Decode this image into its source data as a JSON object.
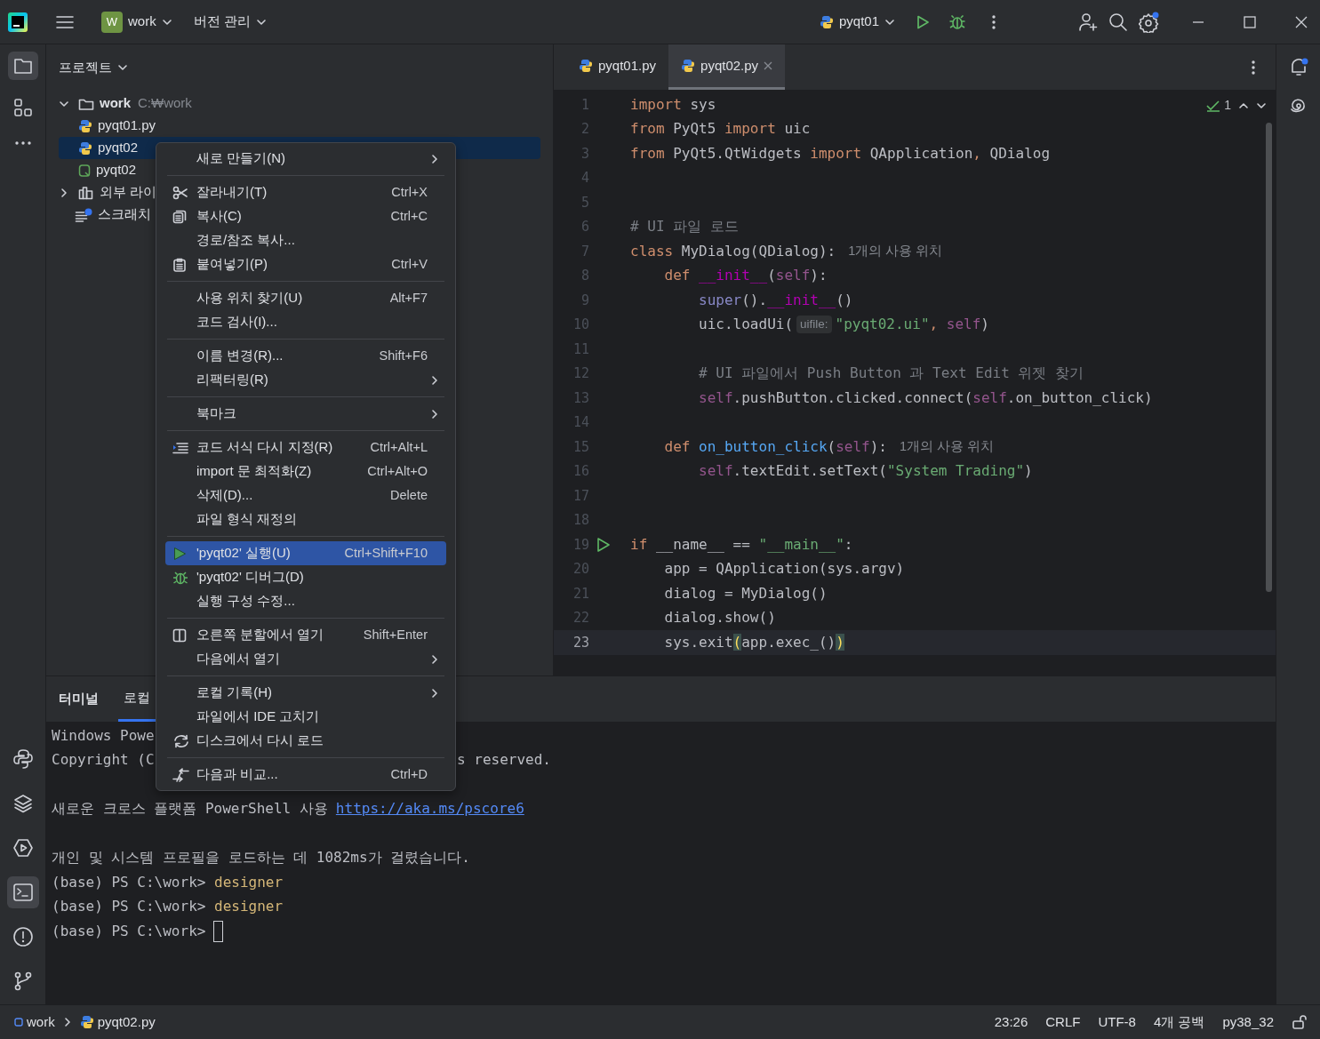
{
  "title_bar": {
    "project_initial": "W",
    "project": "work",
    "vcs": "버전 관리",
    "run_config": "pyqt01"
  },
  "project_panel": {
    "title": "프로젝트",
    "tree": [
      {
        "label": "work",
        "path": "C:₩work",
        "kind": "folder",
        "expanded": true,
        "selected": false,
        "children": [
          {
            "label": "pyqt01.py",
            "kind": "python",
            "selected": false
          },
          {
            "label": "pyqt02",
            "kind": "python",
            "selected": true
          },
          {
            "label": "pyqt02",
            "kind": "qt",
            "selected": false
          }
        ]
      },
      {
        "label": "외부 라이",
        "kind": "library",
        "expanded": false,
        "selected": false
      },
      {
        "label": "스크래치",
        "kind": "scratch",
        "selected": false
      }
    ]
  },
  "editor": {
    "tabs": [
      {
        "label": "pyqt01.py",
        "selected": false
      },
      {
        "label": "pyqt02.py",
        "selected": true
      }
    ],
    "inspections": "1",
    "lines": [
      {
        "number": "1",
        "current": false,
        "run": false,
        "tokens": [
          {
            "kind": "keyword",
            "text": "import"
          },
          {
            "kind": "plain",
            "text": " sys"
          }
        ]
      },
      {
        "number": "2",
        "current": false,
        "run": false,
        "tokens": [
          {
            "kind": "keyword",
            "text": "from"
          },
          {
            "kind": "plain",
            "text": " PyQt5 "
          },
          {
            "kind": "keyword",
            "text": "import"
          },
          {
            "kind": "plain",
            "text": " uic"
          }
        ]
      },
      {
        "number": "3",
        "current": false,
        "run": false,
        "tokens": [
          {
            "kind": "keyword",
            "text": "from"
          },
          {
            "kind": "plain",
            "text": " PyQt5.QtWidgets "
          },
          {
            "kind": "keyword",
            "text": "import"
          },
          {
            "kind": "plain",
            "text": " QApplication"
          },
          {
            "kind": "keyword",
            "text": ","
          },
          {
            "kind": "plain",
            "text": " QDialog"
          }
        ]
      },
      {
        "number": "4",
        "current": false,
        "run": false
      },
      {
        "number": "5",
        "current": false,
        "run": false
      },
      {
        "number": "6",
        "current": false,
        "run": false,
        "tokens": [
          {
            "kind": "comment",
            "text": "# UI 파일 로드"
          }
        ]
      },
      {
        "number": "7",
        "current": false,
        "run": false,
        "tokens": [
          {
            "kind": "keyword",
            "text": "class"
          },
          {
            "kind": "plain",
            "text": " MyDialog(QDialog):"
          },
          {
            "kind": "hint",
            "text": "1개의 사용 위치"
          }
        ]
      },
      {
        "number": "8",
        "current": false,
        "run": false,
        "tokens": [
          {
            "kind": "keyword",
            "text": "    def"
          },
          {
            "kind": "magic",
            "text": " __init__"
          },
          {
            "kind": "plain",
            "text": "("
          },
          {
            "kind": "self",
            "text": "self"
          },
          {
            "kind": "plain",
            "text": "):"
          }
        ]
      },
      {
        "number": "9",
        "current": false,
        "run": false,
        "tokens": [
          {
            "kind": "builtin",
            "text": "        super"
          },
          {
            "kind": "plain",
            "text": "()."
          },
          {
            "kind": "magic",
            "text": "__init__"
          },
          {
            "kind": "plain",
            "text": "()"
          }
        ]
      },
      {
        "number": "10",
        "current": false,
        "run": false,
        "tokens": [
          {
            "kind": "plain",
            "text": "        uic.loadUi("
          },
          {
            "kind": "param",
            "text": "uifile:"
          },
          {
            "kind": "string",
            "text": "\"pyqt02.ui\""
          },
          {
            "kind": "keyword",
            "text": ","
          },
          {
            "kind": "self",
            "text": " self"
          },
          {
            "kind": "plain",
            "text": ")"
          }
        ]
      },
      {
        "number": "11",
        "current": false,
        "run": false
      },
      {
        "number": "12",
        "current": false,
        "run": false,
        "tokens": [
          {
            "kind": "comment",
            "text": "        # UI 파일에서 Push Button 과 Text Edit 위젯 찾기"
          }
        ]
      },
      {
        "number": "13",
        "current": false,
        "run": false,
        "tokens": [
          {
            "kind": "self",
            "text": "        self"
          },
          {
            "kind": "plain",
            "text": ".pushButton.clicked.connect("
          },
          {
            "kind": "self",
            "text": "self"
          },
          {
            "kind": "plain",
            "text": ".on_button_click)"
          }
        ]
      },
      {
        "number": "14",
        "current": false,
        "run": false
      },
      {
        "number": "15",
        "current": false,
        "run": false,
        "tokens": [
          {
            "kind": "keyword",
            "text": "    def"
          },
          {
            "kind": "function",
            "text": " on_button_click"
          },
          {
            "kind": "plain",
            "text": "("
          },
          {
            "kind": "self",
            "text": "self"
          },
          {
            "kind": "plain",
            "text": "):"
          },
          {
            "kind": "hint",
            "text": "1개의 사용 위치"
          }
        ]
      },
      {
        "number": "16",
        "current": false,
        "run": false,
        "tokens": [
          {
            "kind": "self",
            "text": "        self"
          },
          {
            "kind": "plain",
            "text": ".textEdit.setText("
          },
          {
            "kind": "string",
            "text": "\"System Trading\""
          },
          {
            "kind": "plain",
            "text": ")"
          }
        ]
      },
      {
        "number": "17",
        "current": false,
        "run": false
      },
      {
        "number": "18",
        "current": false,
        "run": false
      },
      {
        "number": "19",
        "current": false,
        "run": true,
        "tokens": [
          {
            "kind": "keyword",
            "text": "if"
          },
          {
            "kind": "plain",
            "text": " __name__ == "
          },
          {
            "kind": "string",
            "text": "\"__main__\""
          },
          {
            "kind": "plain",
            "text": ":"
          }
        ]
      },
      {
        "number": "20",
        "current": false,
        "run": false,
        "tokens": [
          {
            "kind": "plain",
            "text": "    app = QApplication(sys.argv)"
          }
        ]
      },
      {
        "number": "21",
        "current": false,
        "run": false,
        "tokens": [
          {
            "kind": "plain",
            "text": "    dialog = MyDialog()"
          }
        ]
      },
      {
        "number": "22",
        "current": false,
        "run": false,
        "tokens": [
          {
            "kind": "plain",
            "text": "    dialog.show()"
          }
        ]
      },
      {
        "number": "23",
        "current": true,
        "run": false,
        "tokens": [
          {
            "kind": "plain",
            "text": "    sys.exit"
          },
          {
            "kind": "match",
            "text": "("
          },
          {
            "kind": "plain",
            "text": "app.exec_()"
          },
          {
            "kind": "match",
            "text": ")"
          }
        ]
      }
    ]
  },
  "context_menu": {
    "items": [
      {
        "kind": "item",
        "label": "새로 만들기(N)",
        "submenu": true,
        "selected": false
      },
      {
        "kind": "separator"
      },
      {
        "kind": "cut",
        "label": "잘라내기(T)",
        "shortcut": "Ctrl+X",
        "submenu": false,
        "selected": false
      },
      {
        "kind": "copy",
        "label": "복사(C)",
        "shortcut": "Ctrl+C",
        "submenu": false,
        "selected": false
      },
      {
        "kind": "item",
        "label": "경로/참조 복사...",
        "submenu": false,
        "selected": false
      },
      {
        "kind": "paste",
        "label": "붙여넣기(P)",
        "shortcut": "Ctrl+V",
        "submenu": false,
        "selected": false
      },
      {
        "kind": "separator"
      },
      {
        "kind": "item",
        "label": "사용 위치 찾기(U)",
        "shortcut": "Alt+F7",
        "submenu": false,
        "selected": false
      },
      {
        "kind": "item",
        "label": "코드 검사(I)...",
        "submenu": false,
        "selected": false
      },
      {
        "kind": "separator"
      },
      {
        "kind": "item",
        "label": "이름 변경(R)...",
        "shortcut": "Shift+F6",
        "submenu": false,
        "selected": false
      },
      {
        "kind": "item",
        "label": "리팩터링(R)",
        "submenu": true,
        "selected": false
      },
      {
        "kind": "separator"
      },
      {
        "kind": "item",
        "label": "북마크",
        "submenu": true,
        "selected": false
      },
      {
        "kind": "separator"
      },
      {
        "kind": "reformat",
        "label": "코드 서식 다시 지정(R)",
        "shortcut": "Ctrl+Alt+L",
        "submenu": false,
        "selected": false
      },
      {
        "kind": "item",
        "label": "import 문 최적화(Z)",
        "shortcut": "Ctrl+Alt+O",
        "submenu": false,
        "selected": false
      },
      {
        "kind": "item",
        "label": "삭제(D)...",
        "shortcut": "Delete",
        "submenu": false,
        "selected": false
      },
      {
        "kind": "item",
        "label": "파일 형식 재정의",
        "submenu": false,
        "selected": false
      },
      {
        "kind": "separator"
      },
      {
        "kind": "run",
        "label": "'pyqt02' 실행(U)",
        "shortcut": "Ctrl+Shift+F10",
        "submenu": false,
        "selected": true
      },
      {
        "kind": "debug",
        "label": "'pyqt02' 디버그(D)",
        "submenu": false,
        "selected": false
      },
      {
        "kind": "item",
        "label": "실행 구성 수정...",
        "submenu": false,
        "selected": false
      },
      {
        "kind": "separator"
      },
      {
        "kind": "split",
        "label": "오른쪽 분할에서 열기",
        "shortcut": "Shift+Enter",
        "submenu": false,
        "selected": false
      },
      {
        "kind": "item",
        "label": "다음에서 열기",
        "submenu": true,
        "selected": false
      },
      {
        "kind": "separator"
      },
      {
        "kind": "item",
        "label": "로컬 기록(H)",
        "submenu": true,
        "selected": false
      },
      {
        "kind": "item",
        "label": "파일에서 IDE 고치기",
        "submenu": false,
        "selected": false
      },
      {
        "kind": "reload",
        "label": "디스크에서 다시 로드",
        "submenu": false,
        "selected": false
      },
      {
        "kind": "separator"
      },
      {
        "kind": "compare",
        "label": "다음과 비교...",
        "shortcut": "Ctrl+D",
        "submenu": false,
        "selected": false
      }
    ]
  },
  "bottom_panel": {
    "title": "터미널",
    "tabs": [
      {
        "label": "로컬",
        "selected": true
      }
    ],
    "lines": [
      {
        "kind": "text",
        "cursor": false,
        "segments": [
          {
            "kind": "plain",
            "text": "Windows Powe"
          }
        ]
      },
      {
        "kind": "text",
        "cursor": false,
        "segments": [
          {
            "kind": "plain",
            "text": "Copyright (C"
          },
          {
            "kind": "resumed",
            "text": "s reserved."
          }
        ]
      },
      {
        "kind": "blank"
      },
      {
        "kind": "text",
        "cursor": false,
        "segments": [
          {
            "kind": "plain",
            "text": "새로운 크로스 플랫폼 PowerShell 사용"
          },
          {
            "kind": "link",
            "text": "https://aka.ms/pscore6"
          }
        ]
      },
      {
        "kind": "blank"
      },
      {
        "kind": "text",
        "cursor": false,
        "segments": [
          {
            "kind": "plain",
            "text": "개인 및 시스템 프로필을 로드하는 데 1082ms가 걸렸습니다."
          }
        ]
      },
      {
        "kind": "text",
        "cursor": false,
        "segments": [
          {
            "kind": "plain",
            "text": "(base) PS C:\\work> "
          },
          {
            "kind": "command",
            "text": "designer"
          }
        ]
      },
      {
        "kind": "text",
        "cursor": false,
        "segments": [
          {
            "kind": "plain",
            "text": "(base) PS C:\\work> "
          },
          {
            "kind": "command",
            "text": "designer"
          }
        ]
      },
      {
        "kind": "text",
        "cursor": true,
        "segments": [
          {
            "kind": "plain",
            "text": "(base) PS C:\\work>"
          }
        ]
      }
    ]
  },
  "status_bar": {
    "breadcrumbs": [
      "work",
      "pyqt02.py"
    ],
    "items": [
      "23:26",
      "CRLF",
      "UTF-8",
      "4개 공백",
      "py38_32"
    ]
  }
}
